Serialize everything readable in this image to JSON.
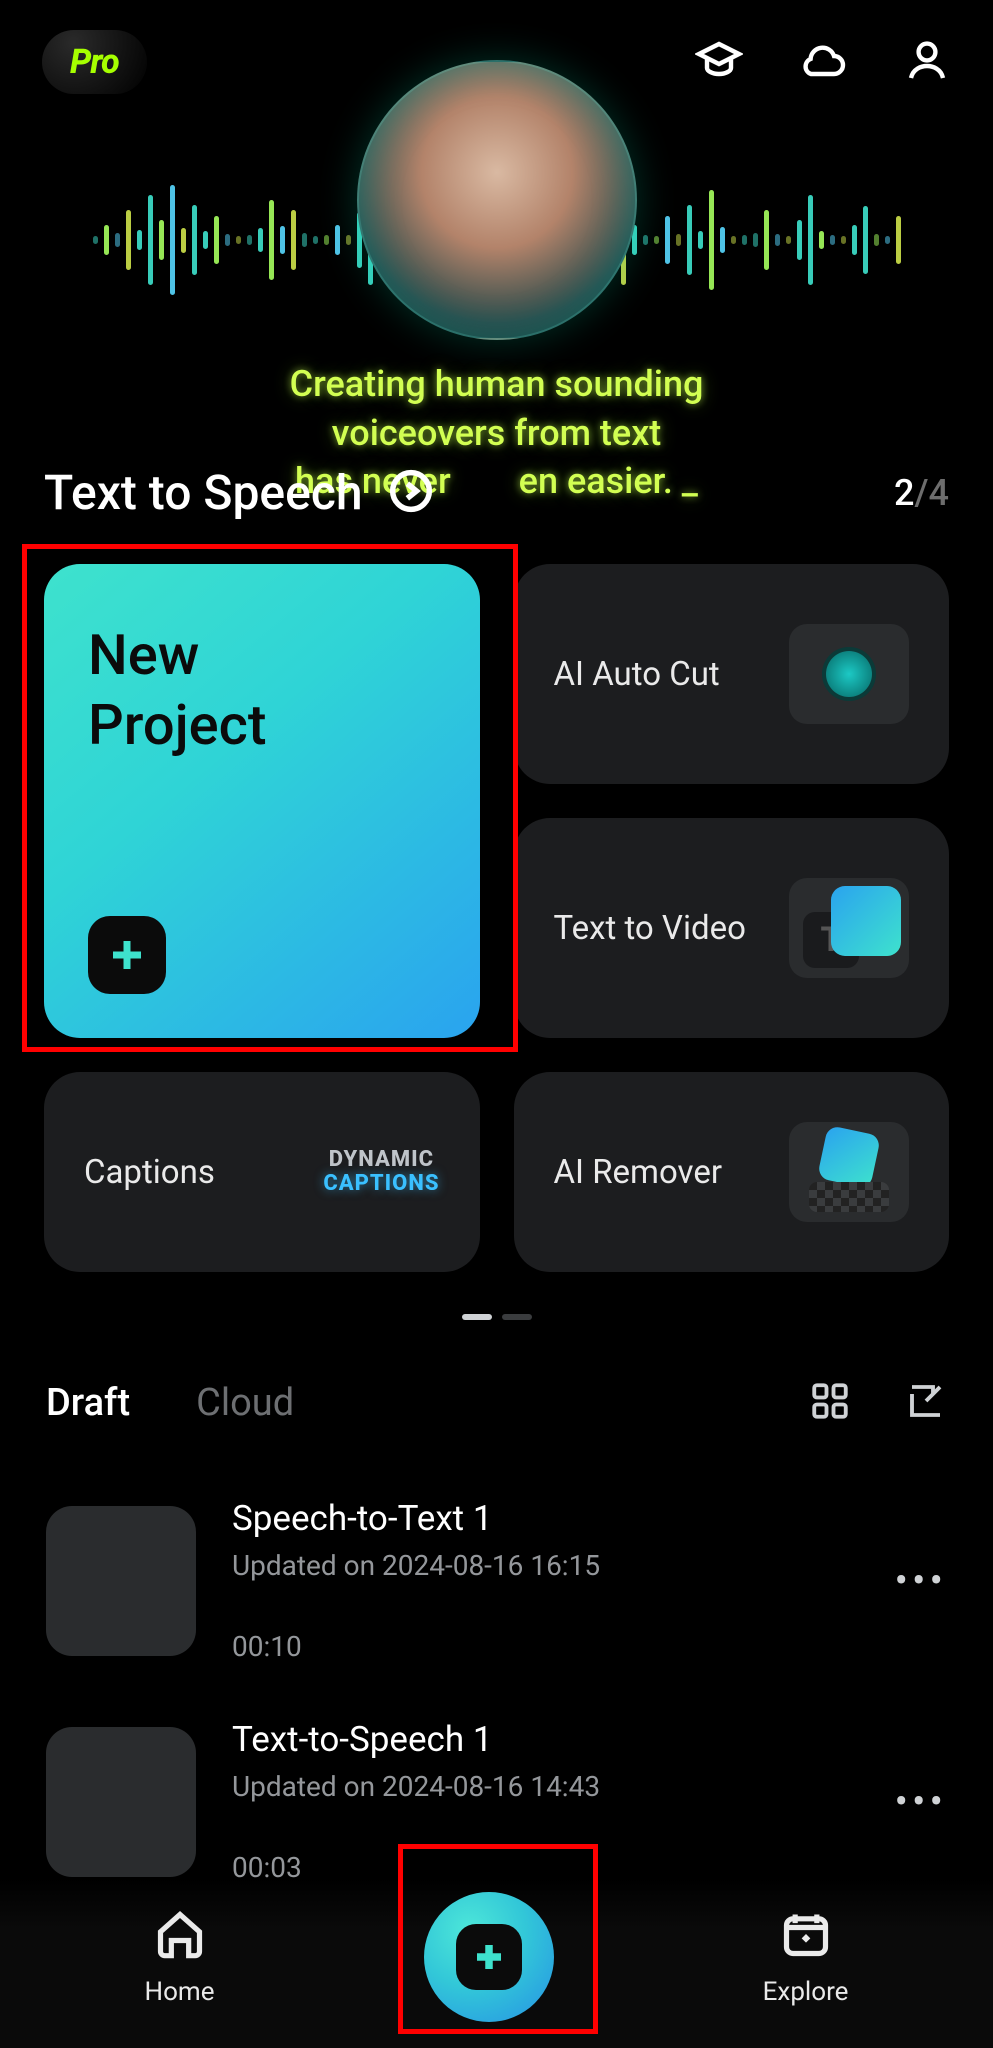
{
  "topbar": {
    "badge": "Pro"
  },
  "hero": {
    "tagline_l1": "Creating human sounding",
    "tagline_l2": "voiceovers from text",
    "tagline_l3_left": "has never",
    "tagline_l3_right": "en easier. _"
  },
  "heading": {
    "title": "Text to Speech",
    "current": "2",
    "total": "/4"
  },
  "tools": {
    "new_project_l1": "New",
    "new_project_l2": "Project",
    "ai_auto_cut": "AI Auto Cut",
    "text_to_video": "Text to Video",
    "captions": "Captions",
    "captions_badge_l1": "DYNAMIC",
    "captions_badge_l2": "CAPTIONS",
    "ai_remover": "AI Remover"
  },
  "tabs": {
    "draft": "Draft",
    "cloud": "Cloud"
  },
  "drafts": [
    {
      "title": "Speech-to-Text 1",
      "updated": "Updated on 2024-08-16 16:15",
      "duration": "00:10"
    },
    {
      "title": "Text-to-Speech 1",
      "updated": "Updated on 2024-08-16 14:43",
      "duration": "00:03"
    }
  ],
  "nav": {
    "home": "Home",
    "explore": "Explore"
  }
}
